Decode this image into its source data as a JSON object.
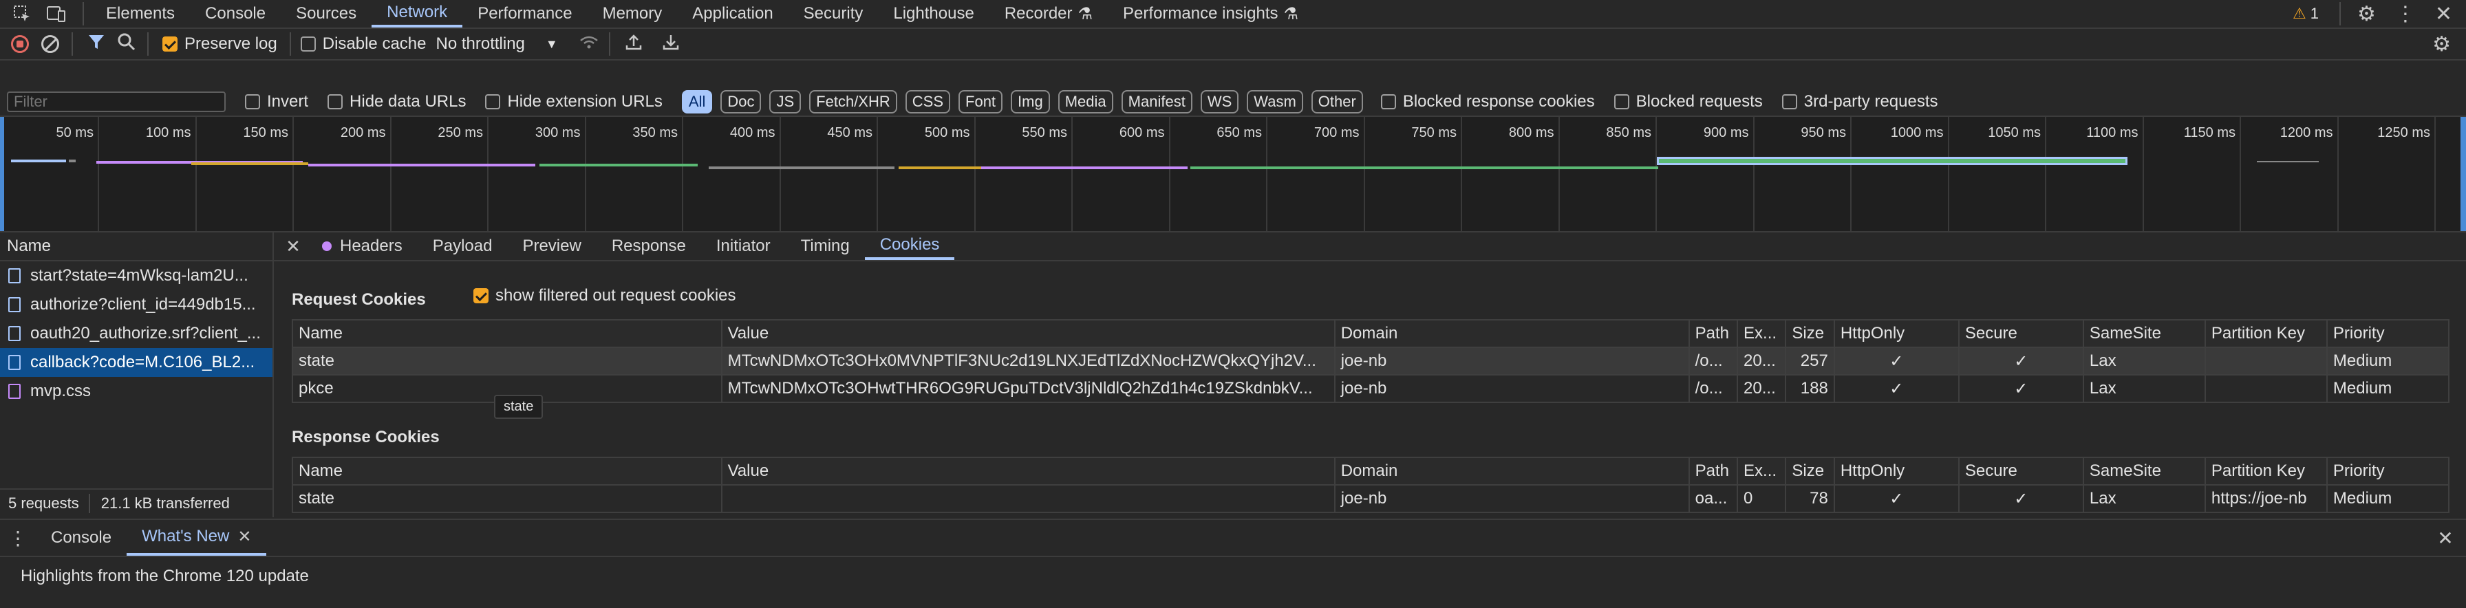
{
  "toolbar": {
    "tabs": [
      "Elements",
      "Console",
      "Sources",
      "Network",
      "Performance",
      "Memory",
      "Application",
      "Security",
      "Lighthouse",
      "Recorder",
      "Performance insights"
    ],
    "active_tab": "Network",
    "issues_count": "1"
  },
  "network_toolbar": {
    "preserve_log": "Preserve log",
    "disable_cache": "Disable cache",
    "throttling": "No throttling"
  },
  "filter_bar": {
    "placeholder": "Filter",
    "invert": "Invert",
    "hide_data_urls": "Hide data URLs",
    "hide_extension_urls": "Hide extension URLs",
    "types": [
      "All",
      "Doc",
      "JS",
      "Fetch/XHR",
      "CSS",
      "Font",
      "Img",
      "Media",
      "Manifest",
      "WS",
      "Wasm",
      "Other"
    ],
    "blocked_response_cookies": "Blocked response cookies",
    "blocked_requests": "Blocked requests",
    "third_party": "3rd-party requests"
  },
  "timeline": {
    "ticks": [
      "50 ms",
      "100 ms",
      "150 ms",
      "200 ms",
      "250 ms",
      "300 ms",
      "350 ms",
      "400 ms",
      "450 ms",
      "500 ms",
      "550 ms",
      "600 ms",
      "650 ms",
      "700 ms",
      "750 ms",
      "800 ms",
      "850 ms",
      "900 ms",
      "950 ms",
      "1000 ms",
      "1050 ms",
      "1100 ms",
      "1150 ms",
      "1200 ms",
      "1250 ms"
    ]
  },
  "requests": {
    "header": "Name",
    "items": [
      {
        "name": "start?state=4mWksq-lam2U...",
        "kind": "doc"
      },
      {
        "name": "authorize?client_id=449db15...",
        "kind": "doc"
      },
      {
        "name": "oauth20_authorize.srf?client_...",
        "kind": "doc"
      },
      {
        "name": "callback?code=M.C106_BL2...",
        "kind": "doc"
      },
      {
        "name": "mvp.css",
        "kind": "css"
      }
    ],
    "summary_requests": "5 requests",
    "summary_transferred": "21.1 kB transferred"
  },
  "detail": {
    "tabs": [
      "Headers",
      "Payload",
      "Preview",
      "Response",
      "Initiator",
      "Timing",
      "Cookies"
    ],
    "active_tab": "Cookies",
    "request_cookies_title": "Request Cookies",
    "show_filtered": "show filtered out request cookies",
    "columns": [
      "Name",
      "Value",
      "Domain",
      "Path",
      "Ex...",
      "Size",
      "HttpOnly",
      "Secure",
      "SameSite",
      "Partition Key",
      "Priority"
    ],
    "request_cookies": [
      {
        "name": "state",
        "value": "MTcwNDMxOTc3OHx0MVNPTlF3NUc2d19LNXJEdTlZdXNocHZWQkxQYjh2V...",
        "domain": "joe-nb",
        "path": "/o...",
        "expires": "20...",
        "size": "257",
        "httponly": "✓",
        "secure": "✓",
        "samesite": "Lax",
        "partition": "",
        "priority": "Medium"
      },
      {
        "name": "pkce",
        "value": "MTcwNDMxOTc3OHwtTHR6OG9RUGpuTDctV3ljNldlQ2hZd1h4c19ZSkdnbkV...",
        "domain": "joe-nb",
        "path": "/o...",
        "expires": "20...",
        "size": "188",
        "httponly": "✓",
        "secure": "✓",
        "samesite": "Lax",
        "partition": "",
        "priority": "Medium"
      }
    ],
    "tooltip": "state",
    "response_cookies_title": "Response Cookies",
    "response_cookies": [
      {
        "name": "state",
        "value": "",
        "domain": "joe-nb",
        "path": "oa...",
        "expires": "0",
        "size": "78",
        "httponly": "✓",
        "secure": "✓",
        "samesite": "Lax",
        "partition": "https://joe-nb",
        "priority": "Medium"
      }
    ]
  },
  "drawer": {
    "tabs": [
      "Console",
      "What's New"
    ],
    "active_tab": "What's New",
    "content": "Highlights from the Chrome 120 update"
  },
  "colors": {
    "accent": "#a8c7fa",
    "record": "#e46962",
    "warning": "#f5a623"
  }
}
